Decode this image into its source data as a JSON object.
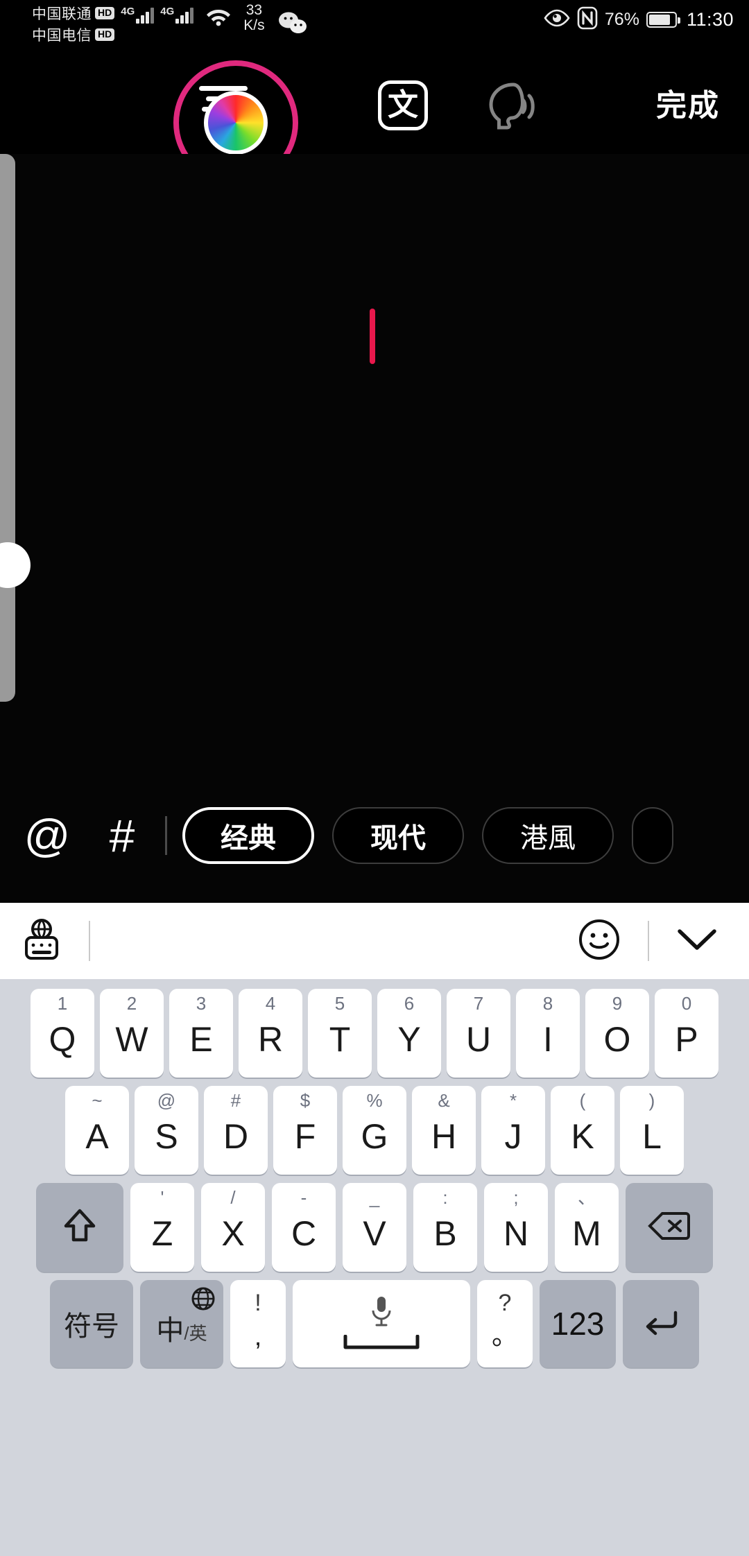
{
  "status_bar": {
    "carriers": [
      {
        "name": "中国联通",
        "badge": "HD",
        "network": "4G"
      },
      {
        "name": "中国电信",
        "badge": "HD",
        "network": "4G"
      }
    ],
    "net_speed_value": "33",
    "net_speed_unit": "K/s",
    "wechat_icon": "wechat-icon",
    "wifi_icon": "wifi-icon",
    "eye_icon": "eye-icon",
    "nfc_icon": "nfc-icon",
    "battery_percent": "76%",
    "battery_level": 76,
    "clock": "11:30"
  },
  "toolbar": {
    "align_icon": "text-align-icon",
    "color_wheel_icon": "color-wheel-icon",
    "text_style_label": "文",
    "speak_icon": "text-to-speech-icon",
    "done_label": "完成"
  },
  "canvas": {
    "caret_color": "#e8184c",
    "side_panel_color": "#9a9a9a"
  },
  "style_bar": {
    "mention_icon": "@",
    "hashtag_icon": "#",
    "chips": [
      {
        "label": "经典",
        "selected": true,
        "style": "bold"
      },
      {
        "label": "现代",
        "selected": false,
        "style": "bold"
      },
      {
        "label": "港風",
        "selected": false,
        "style": "serif"
      },
      {
        "label": "",
        "selected": false,
        "style": "bold"
      }
    ]
  },
  "keyboard_toolbar": {
    "language_keyboard_icon": "globe-keyboard-icon",
    "emoji_icon": "emoji-smiley-icon",
    "collapse_icon": "chevron-down-icon"
  },
  "keyboard": {
    "row1": [
      {
        "sup": "1",
        "main": "Q"
      },
      {
        "sup": "2",
        "main": "W"
      },
      {
        "sup": "3",
        "main": "E"
      },
      {
        "sup": "4",
        "main": "R"
      },
      {
        "sup": "5",
        "main": "T"
      },
      {
        "sup": "6",
        "main": "Y"
      },
      {
        "sup": "7",
        "main": "U"
      },
      {
        "sup": "8",
        "main": "I"
      },
      {
        "sup": "9",
        "main": "O"
      },
      {
        "sup": "0",
        "main": "P"
      }
    ],
    "row2": [
      {
        "sup": "~",
        "main": "A"
      },
      {
        "sup": "@",
        "main": "S"
      },
      {
        "sup": "#",
        "main": "D"
      },
      {
        "sup": "$",
        "main": "F"
      },
      {
        "sup": "%",
        "main": "G"
      },
      {
        "sup": "&",
        "main": "H"
      },
      {
        "sup": "*",
        "main": "J"
      },
      {
        "sup": "(",
        "main": "K"
      },
      {
        "sup": ")",
        "main": "L"
      }
    ],
    "row3": [
      {
        "sup": "'",
        "main": "Z"
      },
      {
        "sup": "/",
        "main": "X"
      },
      {
        "sup": "-",
        "main": "C"
      },
      {
        "sup": "_",
        "main": "V"
      },
      {
        "sup": ":",
        "main": "B"
      },
      {
        "sup": ";",
        "main": "N"
      },
      {
        "sup": "、",
        "main": "M"
      }
    ],
    "shift_icon": "shift-arrow-icon",
    "backspace_icon": "backspace-icon",
    "row4": {
      "symbols_label": "符号",
      "lang_main": "中",
      "lang_sub": "/英",
      "lang_globe_icon": "globe-icon",
      "punct_left_top": "!",
      "punct_left_bottom": ",",
      "space_mic_icon": "microphone-icon",
      "space_icon": "spacebar-icon",
      "punct_right_top": "?",
      "punct_right_bottom": "。",
      "numeric_label": "123",
      "enter_icon": "enter-arrow-icon"
    }
  }
}
